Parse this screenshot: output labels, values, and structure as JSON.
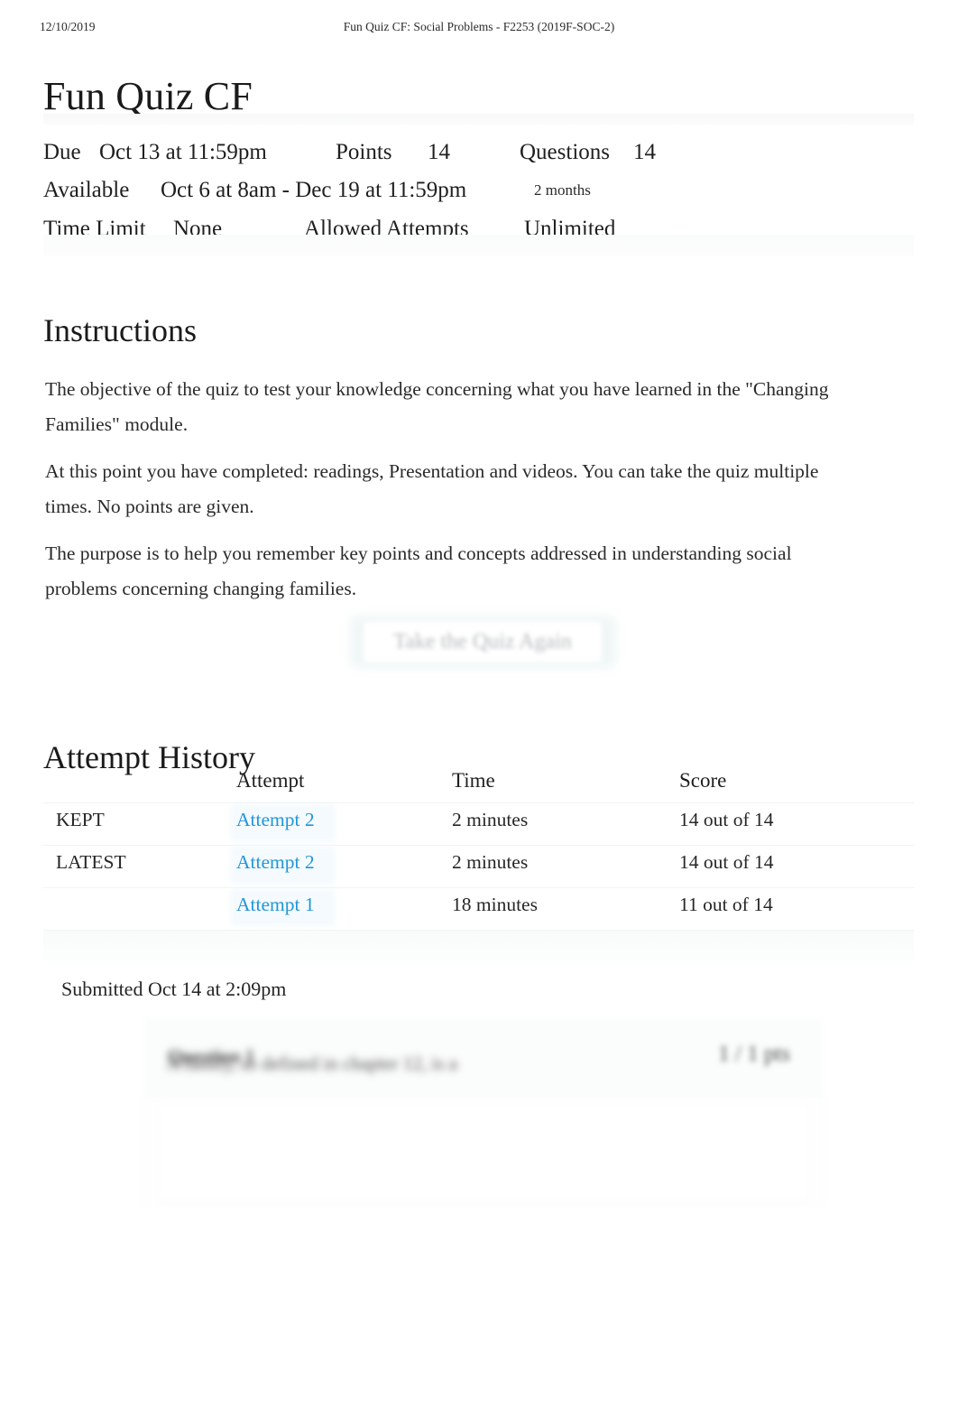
{
  "print_header": {
    "date": "12/10/2019",
    "document_title": "Fun Quiz CF: Social Problems - F2253 (2019F-SOC-2)"
  },
  "page_title": "Fun Quiz CF",
  "quiz_meta": {
    "due_label": "Due",
    "due_value": "Oct 13 at 11:59pm",
    "points_label": "Points",
    "points_value": "14",
    "questions_label": "Questions",
    "questions_value": "14",
    "available_label": "Available",
    "available_value": "Oct 6 at 8am - Dec 19 at 11:59pm",
    "available_duration": "2 months",
    "time_limit_label": "Time Limit",
    "time_limit_value": "None",
    "allowed_attempts_label": "Allowed Attempts",
    "allowed_attempts_value": "Unlimited"
  },
  "instructions": {
    "heading": "Instructions",
    "paragraphs": [
      "The objective of the quiz to test your knowledge concerning what you have learned in the \"Changing Families\" module.",
      "At this point you have completed: readings, Presentation and videos. You can take the quiz multiple times. No points are given.",
      "The purpose is to help you remember key points and concepts addressed in understanding social problems concerning changing families."
    ]
  },
  "take_quiz_button": {
    "label": "Take the Quiz Again"
  },
  "attempt_history": {
    "heading": "Attempt History",
    "columns": {
      "status": "",
      "attempt": "Attempt",
      "time": "Time",
      "score": "Score"
    },
    "rows": [
      {
        "status": "KEPT",
        "attempt": "Attempt 2",
        "time": "2 minutes",
        "score": "14 out of 14"
      },
      {
        "status": "LATEST",
        "attempt": "Attempt 2",
        "time": "2 minutes",
        "score": "14 out of 14"
      },
      {
        "status": "",
        "attempt": "Attempt 1",
        "time": "18 minutes",
        "score": "11 out of 14"
      }
    ]
  },
  "submission": {
    "submitted_text": "Submitted Oct 14 at 2:09pm"
  },
  "question": {
    "number_label": "Question 1",
    "points": "1 / 1 pts",
    "text": "A family, as defined in chapter 12, is a"
  },
  "colors": {
    "link": "#2196d8",
    "text": "#2d3b45",
    "muted": "#8d9397",
    "rule": "#f1f4f5",
    "band": "#f7f8f8"
  }
}
